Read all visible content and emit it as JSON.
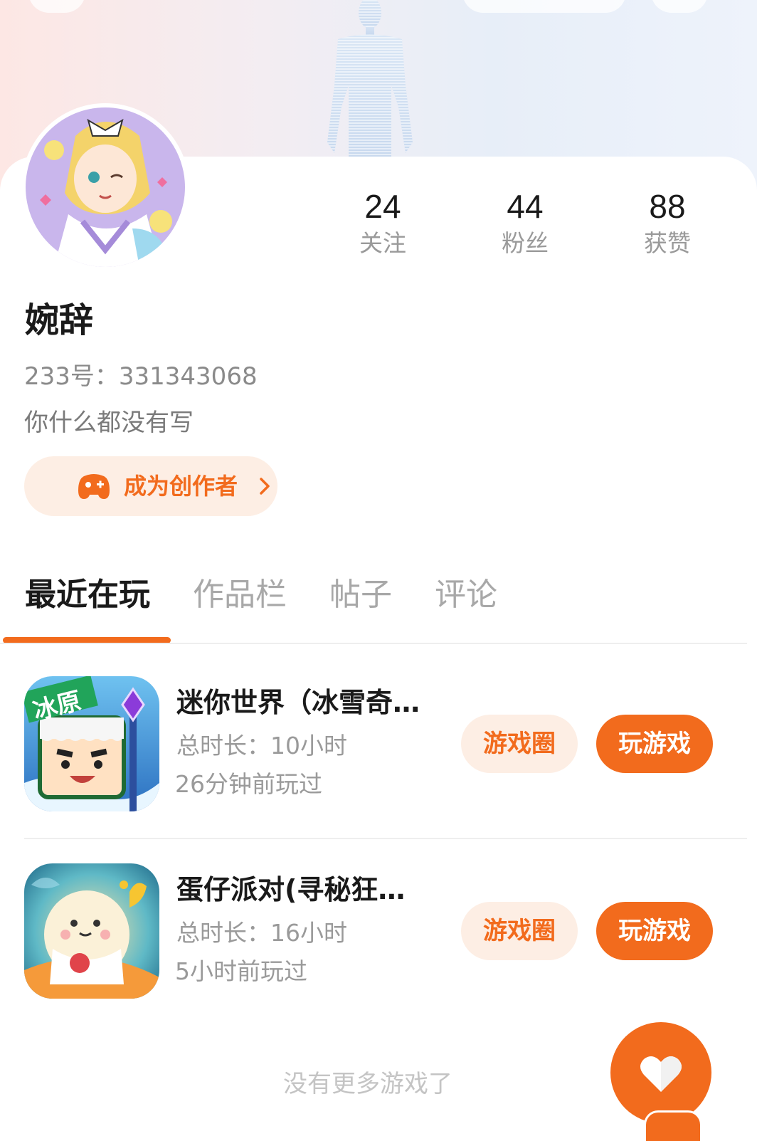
{
  "profile": {
    "nickname": "婉辞",
    "account_id": "233号：331343068",
    "bio": "你什么都没有写",
    "creator_button": "成为创作者"
  },
  "stats": [
    {
      "value": "24",
      "label": "关注"
    },
    {
      "value": "44",
      "label": "粉丝"
    },
    {
      "value": "88",
      "label": "获赞"
    }
  ],
  "tabs": [
    {
      "label": "最近在玩",
      "active": true
    },
    {
      "label": "作品栏",
      "active": false
    },
    {
      "label": "帖子",
      "active": false
    },
    {
      "label": "评论",
      "active": false
    }
  ],
  "games": [
    {
      "title": "迷你世界（冰雪奇…",
      "duration": "总时长：10小时",
      "last_played": "26分钟前玩过",
      "circle_button": "游戏圈",
      "play_button": "玩游戏",
      "icon": "mini-world-game-icon",
      "icon_text": "冰原"
    },
    {
      "title": "蛋仔派对(寻秘狂…",
      "duration": "总时长：16小时",
      "last_played": "5小时前玩过",
      "circle_button": "游戏圈",
      "play_button": "玩游戏",
      "icon": "eggy-party-game-icon"
    }
  ],
  "footer": {
    "no_more": "没有更多游戏了"
  },
  "colors": {
    "accent": "#f26b1d",
    "accent_light": "#fdeee4",
    "text_primary": "#1a1a1a",
    "text_secondary": "#9a9a9a"
  }
}
